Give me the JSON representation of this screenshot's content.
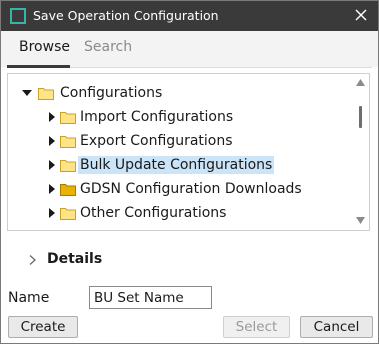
{
  "window": {
    "title": "Save Operation Configuration",
    "accent": "#3db3a8",
    "titlebar_bg": "#3a3a3a"
  },
  "tabs": [
    {
      "label": "Browse",
      "active": true
    },
    {
      "label": "Search",
      "active": false
    }
  ],
  "tree": {
    "root": {
      "label": "Configurations",
      "expanded": true,
      "icon": "folder-icon"
    },
    "children": [
      {
        "label": "Import Configurations",
        "expanded": false,
        "selected": false,
        "icon": "folder-icon"
      },
      {
        "label": "Export Configurations",
        "expanded": false,
        "selected": false,
        "icon": "folder-icon"
      },
      {
        "label": "Bulk Update Configurations",
        "expanded": false,
        "selected": true,
        "icon": "folder-icon"
      },
      {
        "label": "GDSN Configuration Downloads",
        "expanded": false,
        "selected": false,
        "icon": "folder-dark-icon"
      },
      {
        "label": "Other Configurations",
        "expanded": false,
        "selected": false,
        "icon": "folder-icon"
      }
    ],
    "selection_color": "#cce4f7"
  },
  "details": {
    "label": "Details",
    "expanded": false
  },
  "name_field": {
    "label": "Name",
    "value": "BU Set Name"
  },
  "buttons": {
    "create": "Create",
    "select": "Select",
    "cancel": "Cancel",
    "select_enabled": false
  }
}
